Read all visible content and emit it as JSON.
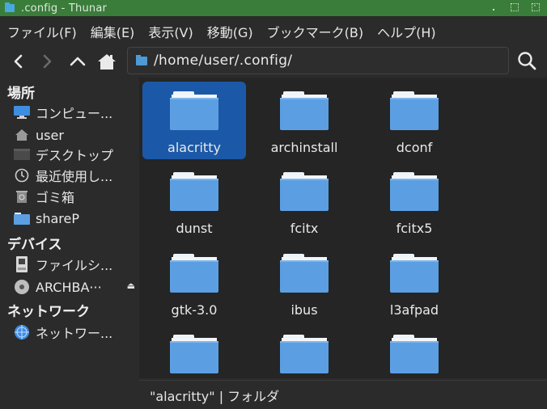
{
  "window": {
    "title": ".config - Thunar"
  },
  "menu": [
    "ファイル(F)",
    "編集(E)",
    "表示(V)",
    "移動(G)",
    "ブックマーク(B)",
    "ヘルプ(H)"
  ],
  "location": {
    "path": "/home/user/.config/"
  },
  "sidebar": {
    "places_heading": "場所",
    "places": [
      {
        "label": "コンピュー...",
        "icon": "computer-icon"
      },
      {
        "label": "user",
        "icon": "home-icon"
      },
      {
        "label": "デスクトップ",
        "icon": "desktop-icon"
      },
      {
        "label": "最近使用し...",
        "icon": "recent-icon"
      },
      {
        "label": "ゴミ箱",
        "icon": "trash-icon"
      },
      {
        "label": "shareP",
        "icon": "folder-icon"
      }
    ],
    "devices_heading": "デバイス",
    "devices": [
      {
        "label": "ファイルシ...",
        "icon": "drive-icon"
      },
      {
        "label": "ARCHBA···",
        "icon": "disc-icon"
      }
    ],
    "network_heading": "ネットワーク",
    "network": [
      {
        "label": "ネットワー...",
        "icon": "network-icon"
      }
    ]
  },
  "files": [
    {
      "name": "alacritty",
      "selected": true
    },
    {
      "name": "archinstall"
    },
    {
      "name": "dconf"
    },
    {
      "name": "dunst"
    },
    {
      "name": "fcitx"
    },
    {
      "name": "fcitx5"
    },
    {
      "name": "gtk-3.0"
    },
    {
      "name": "ibus"
    },
    {
      "name": "l3afpad"
    },
    {
      "name": ""
    },
    {
      "name": ""
    },
    {
      "name": ""
    }
  ],
  "status": {
    "text": "\"alacritty\"  |  フォルダ"
  },
  "colors": {
    "titlebar": "#3a7d3a",
    "selection": "#1b59a8",
    "folder": "#5b9fe2"
  }
}
